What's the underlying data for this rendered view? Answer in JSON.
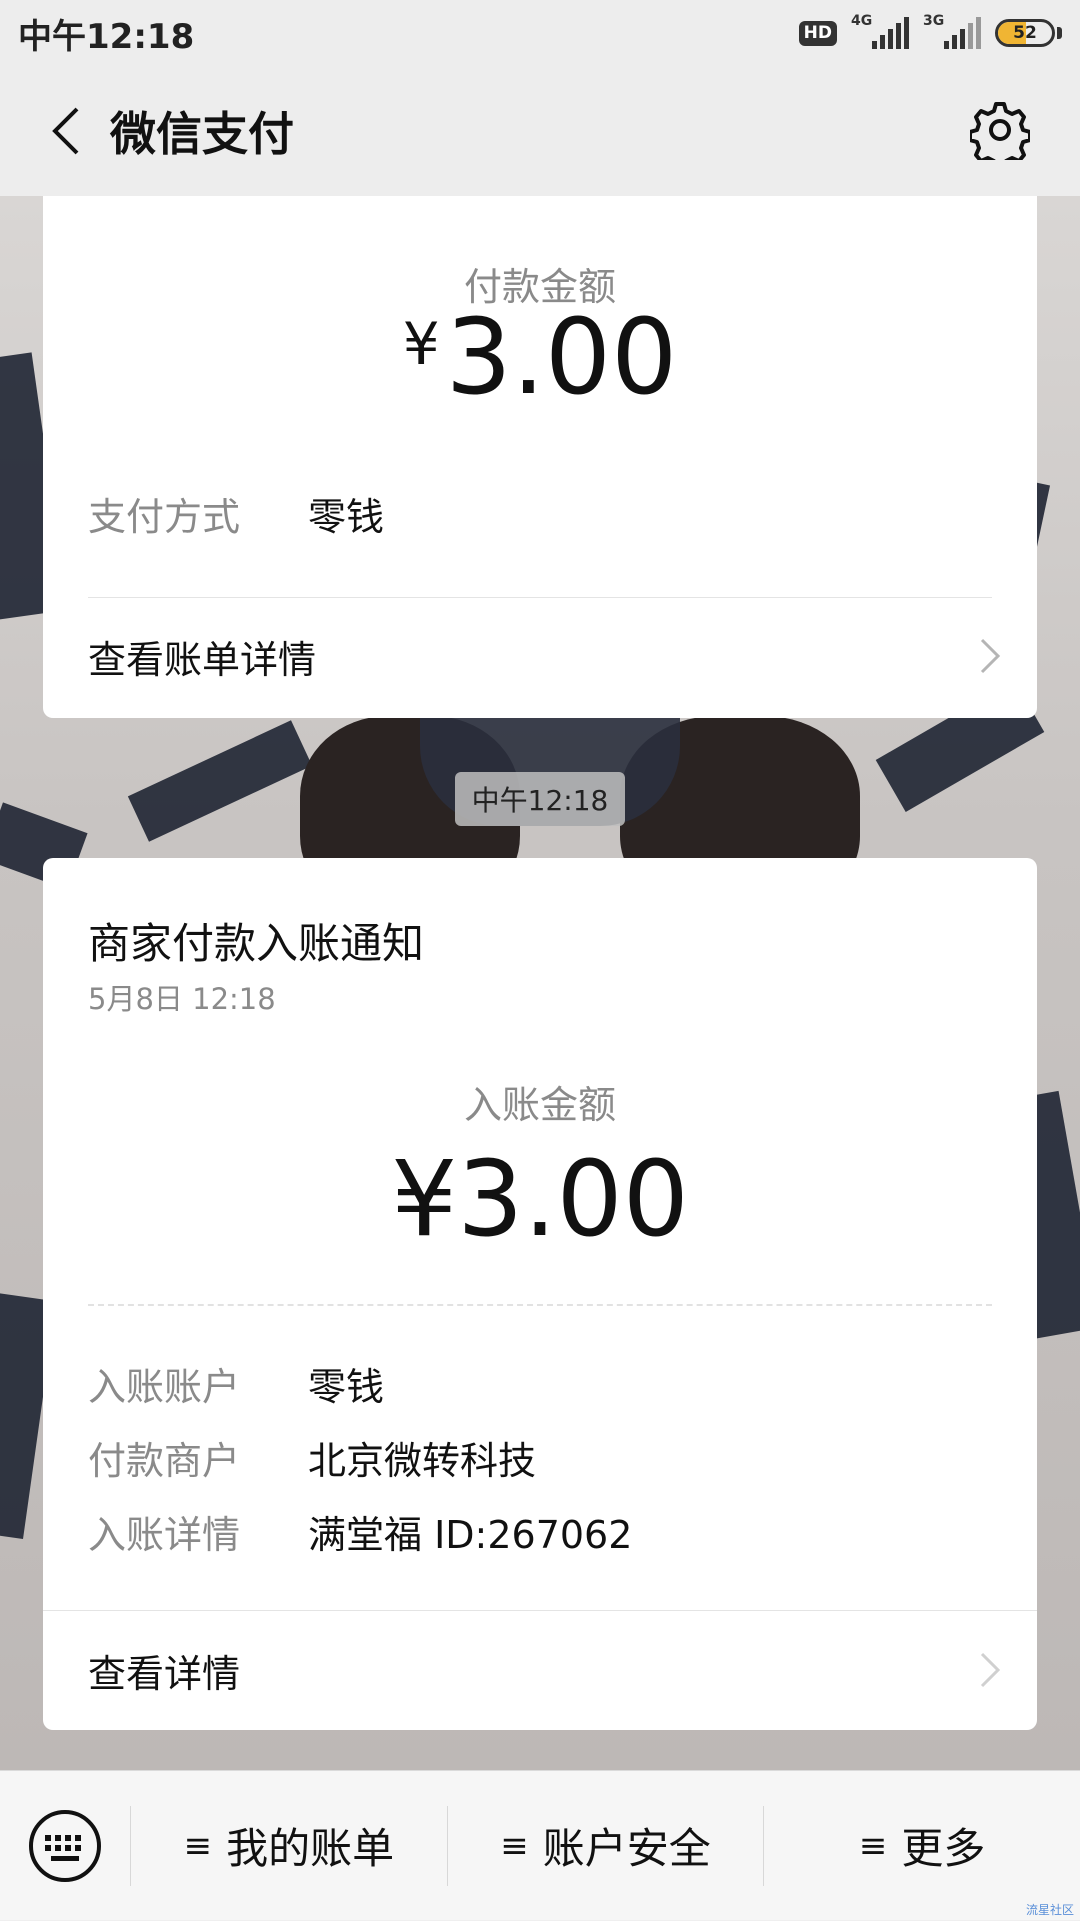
{
  "status_bar": {
    "time": "中午12:18",
    "hd_label": "HD",
    "network1": "4G",
    "network2": "3G",
    "battery_percent": 52
  },
  "nav": {
    "title": "微信支付"
  },
  "payment_card": {
    "amount_label": "付款金额",
    "currency": "¥",
    "amount": "3.00",
    "method_key": "支付方式",
    "method_value": "零钱",
    "view_bill_label": "查看账单详情"
  },
  "timestamp_pill": "中午12:18",
  "notice_card": {
    "title": "商家付款入账通知",
    "date": "5月8日  12:18",
    "amount_label": "入账金额",
    "amount": "¥3.00",
    "rows": [
      {
        "key": "入账账户",
        "value": "零钱"
      },
      {
        "key": "付款商户",
        "value": "北京微转科技"
      },
      {
        "key": "入账详情",
        "value": "满堂福 ID:267062"
      }
    ],
    "view_details_label": "查看详情"
  },
  "bottom_menu": {
    "items": [
      "我的账单",
      "账户安全",
      "更多"
    ]
  },
  "watermark": "流星社区",
  "colors": {
    "background": "#ededed",
    "card": "#ffffff",
    "muted_text": "#8a8a8a",
    "battery_fill": "#f0b533"
  },
  "icons": [
    "back-arrow-icon",
    "gear-icon",
    "chevron-right-icon",
    "keyboard-icon",
    "hamburger-icon"
  ]
}
